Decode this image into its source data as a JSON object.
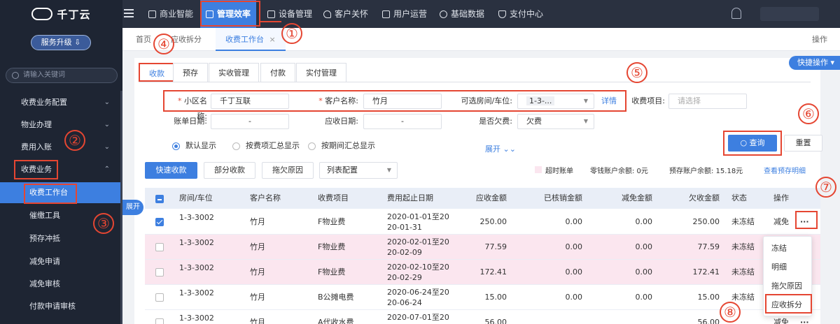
{
  "brand": {
    "name": "千丁云"
  },
  "sidebar": {
    "upgrade_label": "服务升级 ⇩",
    "search_placeholder": "请输入关键词",
    "menus": [
      {
        "label": "收费业务配置",
        "chev": "⌄"
      },
      {
        "label": "物业办理",
        "chev": "⌄"
      },
      {
        "label": "费用入账",
        "chev": "⌄"
      },
      {
        "label": "收费业务",
        "chev": "⌃"
      }
    ],
    "subs": [
      {
        "label": "收费工作台"
      },
      {
        "label": "催缴工具"
      },
      {
        "label": "预存冲抵"
      },
      {
        "label": "减免申请"
      },
      {
        "label": "减免审核"
      },
      {
        "label": "付款申请审核"
      }
    ]
  },
  "topnav": [
    {
      "label": "商业智能",
      "icon": "chart-icon"
    },
    {
      "label": "管理效率",
      "icon": "trend-icon"
    },
    {
      "label": "设备管理",
      "icon": "device-icon"
    },
    {
      "label": "客户关怀",
      "icon": "heart-icon"
    },
    {
      "label": "用户运营",
      "icon": "user-icon"
    },
    {
      "label": "基础数据",
      "icon": "wrench-icon"
    },
    {
      "label": "支付中心",
      "icon": "shield-icon"
    }
  ],
  "tabs": [
    {
      "label": "首页"
    },
    {
      "label": "应收拆分"
    },
    {
      "label": "收费工作台",
      "close": "×"
    }
  ],
  "ops_label": "操作",
  "quick_ops_label": "快捷操作 ▾",
  "expand_side_label": "展开",
  "subtabs": [
    {
      "label": "收款"
    },
    {
      "label": "预存"
    },
    {
      "label": "实收管理"
    },
    {
      "label": "付款"
    },
    {
      "label": "实付管理"
    }
  ],
  "form": {
    "community_label": "小区名称:",
    "community_value": "千丁互联",
    "customer_label": "客户名称:",
    "customer_value": "竹月",
    "room_label": "可选房间/车位:",
    "room_value": "1-3-...",
    "detail_link": "详情",
    "fee_item_label": "收费项目:",
    "fee_item_placeholder": "请选择",
    "bill_date_label": "账单日期:",
    "bill_date_value": "-",
    "due_date_label": "应收日期:",
    "due_date_value": "-",
    "arrears_label": "是否欠费:",
    "arrears_value": "欠费",
    "radios": [
      "默认显示",
      "按费项汇总显示",
      "按期间汇总显示"
    ],
    "expand_label": "展开 ⌄⌄",
    "query_label": "查询",
    "reset_label": "重置"
  },
  "toolbar": {
    "quick_collect": "快速收款",
    "partial_collect": "部分收款",
    "arrears_reason": "拖欠原因",
    "column_config": "列表配置",
    "overdue_label": "超时账单",
    "zero_balance_label": "零钱账户余额: 0元",
    "prestore_balance_label": "预存账户余额: 15.18元",
    "prestore_detail_link": "查看预存明细"
  },
  "table": {
    "headers": [
      "房间/车位",
      "客户名称",
      "收费项目",
      "费用起止日期",
      "应收金额",
      "已核销金额",
      "减免金额",
      "欠收金额",
      "状态",
      "操作"
    ],
    "rows": [
      {
        "room": "1-3-3002",
        "customer": "竹月",
        "item": "F物业费",
        "date1": "2020-01-01至20",
        "date2": "20-01-31",
        "due": "250.00",
        "written": "0.00",
        "waived": "0.00",
        "owed": "250.00",
        "status": "未冻结",
        "op": "减免",
        "more": "···"
      },
      {
        "room": "1-3-3002",
        "customer": "竹月",
        "item": "F物业费",
        "date1": "2020-02-01至20",
        "date2": "20-02-09",
        "due": "77.59",
        "written": "0.00",
        "waived": "0.00",
        "owed": "77.59",
        "status": "未冻结"
      },
      {
        "room": "1-3-3002",
        "customer": "竹月",
        "item": "F物业费",
        "date1": "2020-02-10至20",
        "date2": "20-02-29",
        "due": "172.41",
        "written": "0.00",
        "waived": "0.00",
        "owed": "172.41",
        "status": "未冻结"
      },
      {
        "room": "1-3-3002",
        "customer": "竹月",
        "item": "B公摊电费",
        "date1": "2020-06-24至20",
        "date2": "20-06-24",
        "due": "15.00",
        "written": "0.00",
        "waived": "0.00",
        "owed": "15.00",
        "status": "未冻结"
      },
      {
        "room": "1-3-3002",
        "customer": "竹月",
        "item": "A代收水费",
        "date1": "2020-07-01至20",
        "date2": "",
        "due": "56.00",
        "written": "",
        "waived": "",
        "owed": "56.00",
        "status": "",
        "op": "减免",
        "more": "···"
      }
    ]
  },
  "popup": [
    "冻结",
    "明细",
    "拖欠原因",
    "应收拆分"
  ],
  "annotations": [
    "①",
    "②",
    "③",
    "④",
    "⑤",
    "⑥",
    "⑦",
    "⑧"
  ],
  "colors": {
    "accent": "#3d7fe0",
    "annotation": "#e54632",
    "sidebar": "#1e2533",
    "topbar": "#2a3140",
    "pink_row": "#fbe6ef"
  }
}
